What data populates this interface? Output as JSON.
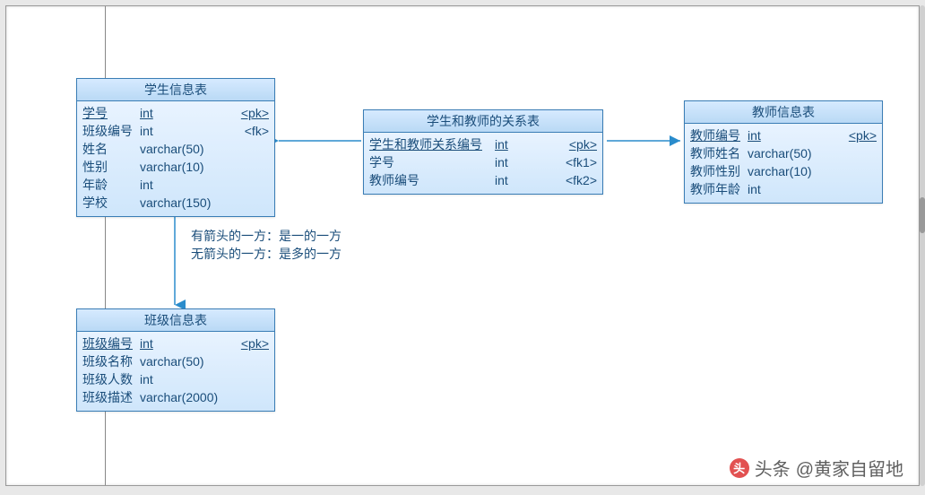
{
  "entities": {
    "student": {
      "title": "学生信息表",
      "rows": [
        {
          "name": "学号",
          "type": "int",
          "key": "<pk>",
          "u": true
        },
        {
          "name": "班级编号",
          "type": "int",
          "key": "<fk>",
          "u": false
        },
        {
          "name": "姓名",
          "type": "varchar(50)",
          "key": "",
          "u": false
        },
        {
          "name": "性别",
          "type": "varchar(10)",
          "key": "",
          "u": false
        },
        {
          "name": "年龄",
          "type": "int",
          "key": "",
          "u": false
        },
        {
          "name": "学校",
          "type": "varchar(150)",
          "key": "",
          "u": false
        }
      ]
    },
    "relation": {
      "title": "学生和教师的关系表",
      "rows": [
        {
          "name": "学生和教师关系编号",
          "type": "int",
          "key": "<pk>",
          "u": true
        },
        {
          "name": "学号",
          "type": "int",
          "key": "<fk1>",
          "u": false
        },
        {
          "name": "教师编号",
          "type": "int",
          "key": "<fk2>",
          "u": false
        }
      ]
    },
    "teacher": {
      "title": "教师信息表",
      "rows": [
        {
          "name": "教师编号",
          "type": "int",
          "key": "<pk>",
          "u": true
        },
        {
          "name": "教师姓名",
          "type": "varchar(50)",
          "key": "",
          "u": false
        },
        {
          "name": "教师性别",
          "type": "varchar(10)",
          "key": "",
          "u": false
        },
        {
          "name": "教师年龄",
          "type": "int",
          "key": "",
          "u": false
        }
      ]
    },
    "class": {
      "title": "班级信息表",
      "rows": [
        {
          "name": "班级编号",
          "type": "int",
          "key": "<pk>",
          "u": true
        },
        {
          "name": "班级名称",
          "type": "varchar(50)",
          "key": "",
          "u": false
        },
        {
          "name": "班级人数",
          "type": "int",
          "key": "",
          "u": false
        },
        {
          "name": "班级描述",
          "type": "varchar(2000)",
          "key": "",
          "u": false
        }
      ]
    }
  },
  "note": {
    "line1": "有箭头的一方：是一的一方",
    "line2": "无箭头的一方：是多的一方"
  },
  "watermark": {
    "prefix": "头条",
    "text": "@黄家自留地"
  },
  "colors": {
    "arrow": "#2a8ccc"
  }
}
